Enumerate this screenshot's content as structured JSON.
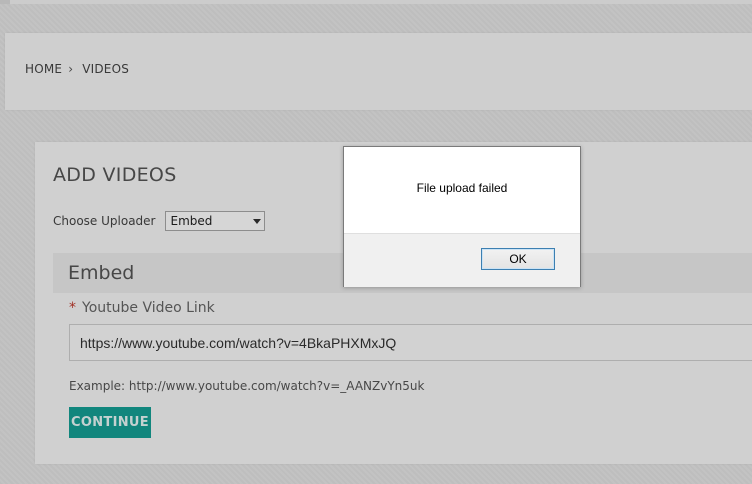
{
  "breadcrumb": {
    "home": "HOME",
    "separator": "›",
    "current": "VIDEOS"
  },
  "add_videos": {
    "title": "ADD VIDEOS",
    "uploader_label": "Choose Uploader",
    "uploader_selected": "Embed"
  },
  "embed": {
    "title": "Embed",
    "required_mark": "*",
    "field_label": "Youtube Video Link",
    "field_value": "https://www.youtube.com/watch?v=4BkaPHXMxJQ",
    "example": "Example: http://www.youtube.com/watch?v=_AANZvYn5uk",
    "continue_label": "CONTINUE"
  },
  "dialog": {
    "message": "File upload failed",
    "ok_label": "OK"
  },
  "colors": {
    "accent": "#15a096",
    "required": "#c0392b",
    "dialog_button_border": "#3c7fb1"
  }
}
